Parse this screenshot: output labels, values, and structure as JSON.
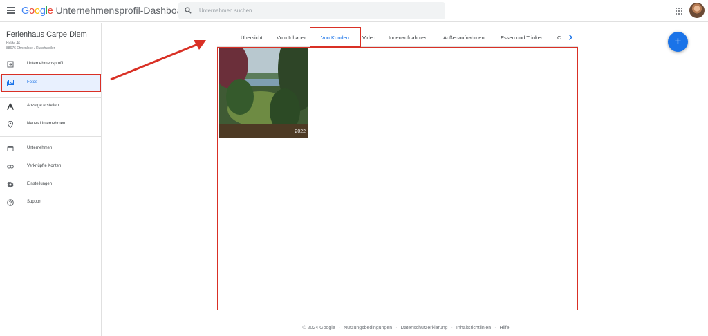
{
  "header": {
    "product_title": "Unternehmensprofil-Dashboard",
    "logo_letters": [
      "G",
      "o",
      "o",
      "g",
      "l",
      "e"
    ],
    "search_placeholder": "Unternehmen suchen",
    "icons": {
      "menu": "menu-icon",
      "search": "search-icon",
      "apps": "apps-grid-icon",
      "account": "avatar"
    }
  },
  "sidebar": {
    "business_name": "Ferienhaus Carpe Diem",
    "address_line1": "Halde 46",
    "address_line2": "88676 Ehnenlose / Ruschweiler",
    "items": [
      {
        "label": "Unternehmensprofil",
        "icon": "profile-enter-icon"
      },
      {
        "label": "Fotos",
        "icon": "photos-icon",
        "active": true
      },
      {
        "label": "Anzeige erstellen",
        "icon": "ads-icon"
      },
      {
        "label": "Neues Unternehmen",
        "icon": "location-pin-icon"
      },
      {
        "label": "Unternehmen",
        "icon": "storefront-icon"
      },
      {
        "label": "Verknüpfte Konten",
        "icon": "link-icon"
      },
      {
        "label": "Einstellungen",
        "icon": "gear-icon"
      },
      {
        "label": "Support",
        "icon": "help-icon"
      }
    ]
  },
  "tabs": [
    {
      "label": "Übersicht"
    },
    {
      "label": "Vom Inhaber"
    },
    {
      "label": "Von Kunden",
      "active": true
    },
    {
      "label": "Video"
    },
    {
      "label": "Innenaufnahmen"
    },
    {
      "label": "Außenaufnahmen"
    },
    {
      "label": "Essen und Trinken"
    },
    {
      "label": "C"
    }
  ],
  "photos": [
    {
      "year_stamp": "2022"
    }
  ],
  "fab_symbol": "+",
  "footer": {
    "copyright": "© 2024 Google",
    "links": [
      "Nutzungsbedingungen",
      "Datenschutzerklärung",
      "Inhaltsrichtlinien",
      "Hilfe"
    ]
  },
  "colors": {
    "accent": "#1a73e8",
    "annotation": "#d93025",
    "active_bg": "#e8f0fe"
  }
}
